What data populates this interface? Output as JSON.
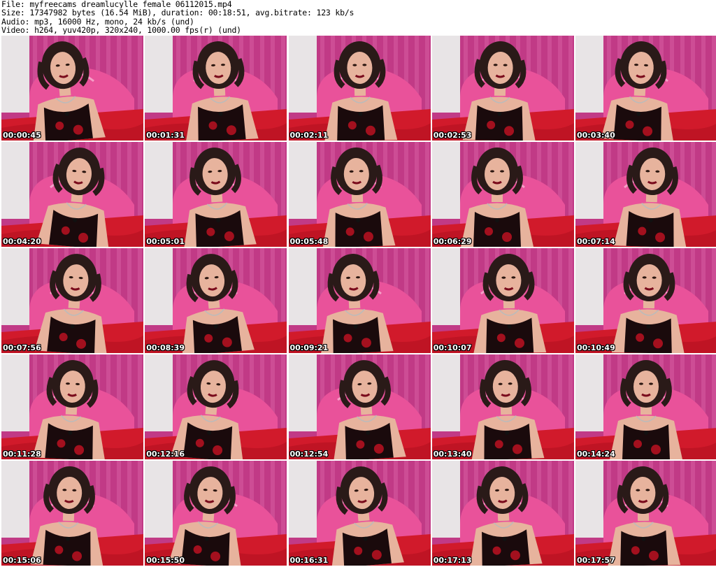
{
  "header": {
    "file_line": "File: myfreecams_dreamlucylle_female_06112015.mp4",
    "size_line": "Size: 17347982 bytes (16.54 MiB), duration: 00:18:51, avg.bitrate: 123 kb/s",
    "audio_line": "Audio: mp3, 16000 Hz, mono, 24 kb/s (und)",
    "video_line": "Video: h264, yuv420p, 320x240, 1000.00 fps(r) (und)"
  },
  "thumbnails": [
    {
      "timestamp": "00:00:45"
    },
    {
      "timestamp": "00:01:31"
    },
    {
      "timestamp": "00:02:11"
    },
    {
      "timestamp": "00:02:53"
    },
    {
      "timestamp": "00:03:40"
    },
    {
      "timestamp": "00:04:20"
    },
    {
      "timestamp": "00:05:01"
    },
    {
      "timestamp": "00:05:48"
    },
    {
      "timestamp": "00:06:29"
    },
    {
      "timestamp": "00:07:14"
    },
    {
      "timestamp": "00:07:56"
    },
    {
      "timestamp": "00:08:39"
    },
    {
      "timestamp": "00:09:21"
    },
    {
      "timestamp": "00:10:07"
    },
    {
      "timestamp": "00:10:49"
    },
    {
      "timestamp": "00:11:28"
    },
    {
      "timestamp": "00:12:16"
    },
    {
      "timestamp": "00:12:54"
    },
    {
      "timestamp": "00:13:40"
    },
    {
      "timestamp": "00:14:24"
    },
    {
      "timestamp": "00:15:06"
    },
    {
      "timestamp": "00:15:50"
    },
    {
      "timestamp": "00:16:31"
    },
    {
      "timestamp": "00:17:13"
    },
    {
      "timestamp": "00:17:57"
    }
  ],
  "colors": {
    "wall": "#c13a86",
    "headboard": "#e9529a",
    "bed": "#d11a2b",
    "side_wall": "#e8e4e6",
    "hair": "#2a1a18",
    "skin": "#e7b39d",
    "dress": "#1a0a0c",
    "dress_pattern": "#a3101e"
  }
}
